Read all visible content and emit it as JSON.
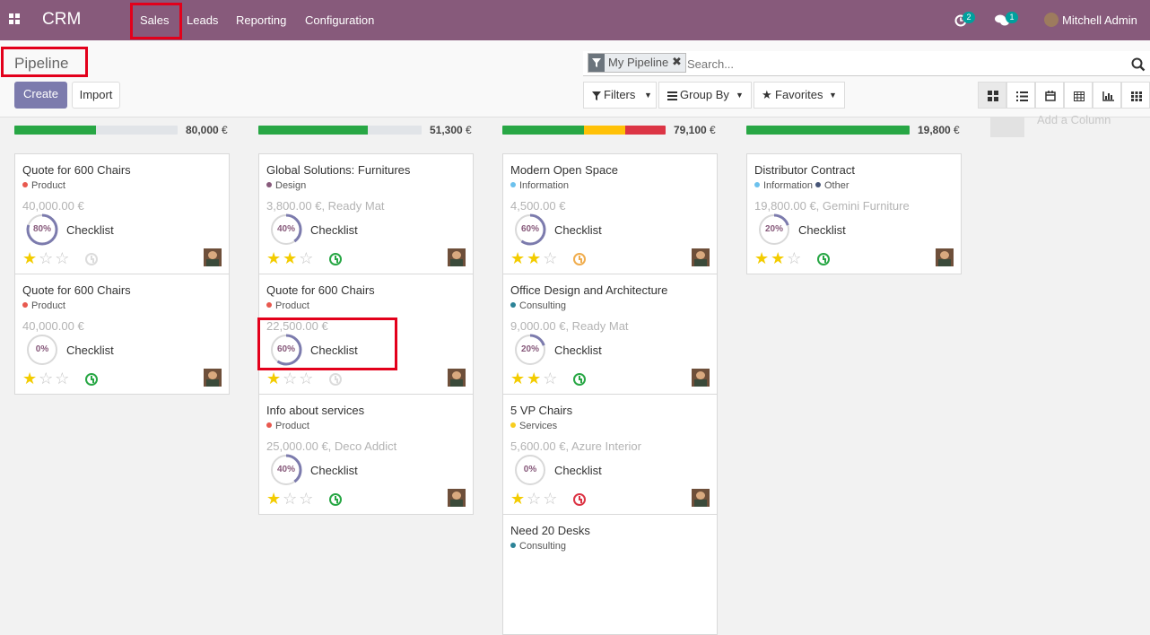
{
  "topbar": {
    "app_name": "CRM",
    "menu": [
      "Sales",
      "Leads",
      "Reporting",
      "Configuration"
    ],
    "activity_count": "2",
    "message_count": "1",
    "user": "Mitchell Admin"
  },
  "control": {
    "title": "Pipeline",
    "create": "Create",
    "import": "Import",
    "facet": "My Pipeline",
    "search_placeholder": "Search...",
    "filters": "Filters",
    "group_by": "Group By",
    "favorites": "Favorites",
    "add_column": "Add a Column"
  },
  "common": {
    "checklist": "Checklist"
  },
  "columns": [
    {
      "total": "80,000",
      "currency": "€",
      "progress": [
        {
          "color": "#28a745",
          "pct": 50
        }
      ]
    },
    {
      "total": "51,300",
      "currency": "€",
      "progress": [
        {
          "color": "#28a745",
          "pct": 67
        }
      ]
    },
    {
      "total": "79,100",
      "currency": "€",
      "progress": [
        {
          "color": "#28a745",
          "pct": 50
        },
        {
          "color": "#ffc107",
          "pct": 25
        },
        {
          "color": "#dc3545",
          "pct": 25
        }
      ]
    },
    {
      "total": "19,800",
      "currency": "€",
      "progress": [
        {
          "color": "#28a745",
          "pct": 100
        }
      ]
    }
  ],
  "cards": [
    [
      {
        "title": "Quote for 600 Chairs",
        "tags": [
          {
            "label": "Product",
            "color": "#e8594f"
          }
        ],
        "amount": "40,000.00 €",
        "pct": 80,
        "stars": 1,
        "activity": "none"
      },
      {
        "title": "Quote for 600 Chairs",
        "tags": [
          {
            "label": "Product",
            "color": "#e8594f"
          }
        ],
        "amount": "40,000.00 €",
        "pct": 0,
        "stars": 1,
        "activity": "green"
      }
    ],
    [
      {
        "title": "Global Solutions: Furnitures",
        "tags": [
          {
            "label": "Design",
            "color": "#875a7b"
          }
        ],
        "amount": "3,800.00 €, Ready Mat",
        "pct": 40,
        "stars": 2,
        "activity": "green"
      },
      {
        "title": "Quote for 600 Chairs",
        "tags": [
          {
            "label": "Product",
            "color": "#e8594f"
          }
        ],
        "amount": "22,500.00 €",
        "pct": 60,
        "stars": 1,
        "activity": "none"
      },
      {
        "title": "Info about services",
        "tags": [
          {
            "label": "Product",
            "color": "#e8594f"
          }
        ],
        "amount": "25,000.00 €, Deco Addict",
        "pct": 40,
        "stars": 1,
        "activity": "green"
      }
    ],
    [
      {
        "title": "Modern Open Space",
        "tags": [
          {
            "label": "Information",
            "color": "#6cc1ed"
          }
        ],
        "amount": "4,500.00 €",
        "pct": 60,
        "stars": 2,
        "activity": "orange"
      },
      {
        "title": "Office Design and Architecture",
        "tags": [
          {
            "label": "Consulting",
            "color": "#2c8397"
          }
        ],
        "amount": "9,000.00 €, Ready Mat",
        "pct": 20,
        "stars": 2,
        "activity": "green"
      },
      {
        "title": "5 VP Chairs",
        "tags": [
          {
            "label": "Services",
            "color": "#f7cd1f"
          }
        ],
        "amount": "5,600.00 €, Azure Interior",
        "pct": 0,
        "stars": 1,
        "activity": "red"
      },
      {
        "title": "Need 20 Desks",
        "tags": [
          {
            "label": "Consulting",
            "color": "#2c8397"
          }
        ],
        "amount": "",
        "pct": 0,
        "stars": 0,
        "activity": "none"
      }
    ],
    [
      {
        "title": "Distributor Contract",
        "tags": [
          {
            "label": "Information",
            "color": "#6cc1ed"
          },
          {
            "label": "Other",
            "color": "#475577"
          }
        ],
        "amount": "19,800.00 €, Gemini Furniture",
        "pct": 20,
        "stars": 2,
        "activity": "green"
      }
    ]
  ],
  "colors": {
    "brand": "#875a7b",
    "highlight": "#e3001b",
    "green": "#28a745",
    "orange": "#f0ad4e",
    "red": "#dc3545"
  }
}
